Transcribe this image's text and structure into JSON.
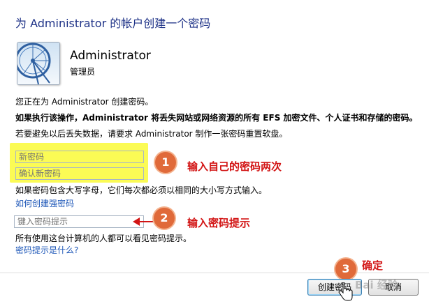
{
  "dialog": {
    "title": "为 Administrator 的帐户创建一个密码",
    "user": {
      "name": "Administrator",
      "role": "管理员"
    },
    "line_creating": "您正在为 Administrator 创建密码。",
    "line_warning": "如果执行该操作，Administrator 将丢失网站或网络资源的所有 EFS 加密文件、个人证书和存储的密码。",
    "line_reset_disk": "若要避免以后丢失数据，请要求 Administrator 制作一张密码重置软盘。",
    "new_password_placeholder": "新密码",
    "confirm_password_placeholder": "确认新密码",
    "case_note": "如果密码包含大写字母，它们每次都必须以相同的大小写方式输入。",
    "strong_password_link": "如何创建强密码",
    "hint_placeholder": "键入密码提示",
    "hint_note": "所有使用这台计算机的人都可以看见密码提示。",
    "hint_link": "密码提示是什么?",
    "create_button": "创建密码",
    "cancel_button": "取消"
  },
  "annotations": {
    "step1": {
      "number": "1",
      "text": "输入自己的密码两次"
    },
    "step2": {
      "number": "2",
      "text": "输入密码提示"
    },
    "step3": {
      "number": "3",
      "text": "确定"
    }
  },
  "watermark": "Bai 经验",
  "colors": {
    "title": "#1e3287",
    "link": "#1e57b8",
    "highlight": "#fbfb55",
    "callout": "#e06a3a",
    "annotation_text": "#d21414"
  }
}
